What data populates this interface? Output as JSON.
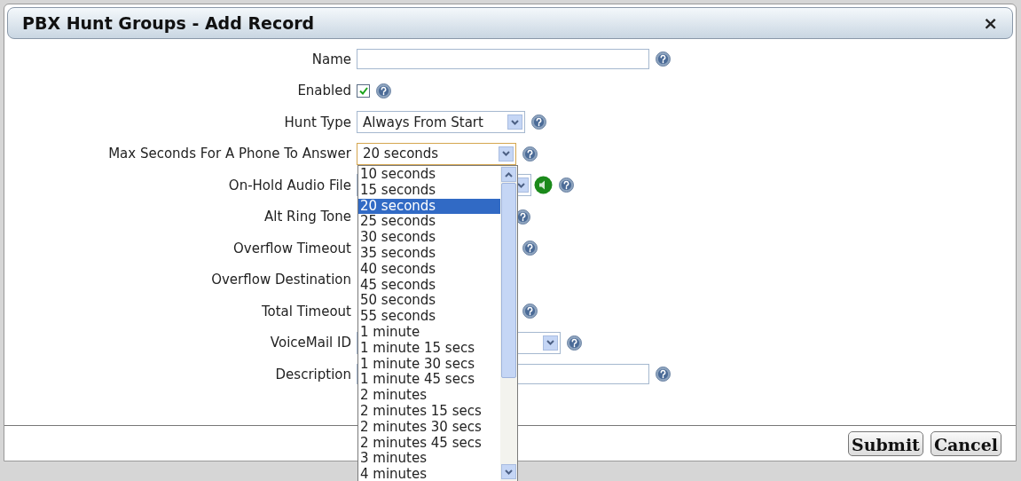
{
  "dialog": {
    "title": "PBX Hunt Groups - Add Record",
    "close": "×"
  },
  "fields": [
    {
      "label": "Name",
      "kind": "text",
      "help": true
    },
    {
      "label": "Enabled",
      "kind": "checkbox",
      "checked": true,
      "help": true
    },
    {
      "label": "Hunt Type",
      "kind": "select",
      "value": "Always From Start",
      "help": true
    },
    {
      "label": "Max Seconds For A Phone To Answer",
      "kind": "select",
      "value": "20 seconds",
      "focused": true,
      "help": true
    },
    {
      "label": "On-Hold Audio File",
      "kind": "audio",
      "help": true
    },
    {
      "label": "Alt Ring Tone",
      "kind": "covered",
      "help": true
    },
    {
      "label": "Overflow Timeout",
      "kind": "covered",
      "help": true
    },
    {
      "label": "Overflow Destination",
      "kind": "covered",
      "help": false
    },
    {
      "label": "Total Timeout",
      "kind": "covered",
      "help": true
    },
    {
      "label": "VoiceMail ID",
      "kind": "select",
      "help": true
    },
    {
      "label": "Description",
      "kind": "text",
      "help": true
    }
  ],
  "dropdown": {
    "options": [
      {
        "label": "10 seconds",
        "selected": false
      },
      {
        "label": "15 seconds",
        "selected": false
      },
      {
        "label": "20 seconds",
        "selected": true
      },
      {
        "label": "25 seconds",
        "selected": false
      },
      {
        "label": "30 seconds",
        "selected": false
      },
      {
        "label": "35 seconds",
        "selected": false
      },
      {
        "label": "40 seconds",
        "selected": false
      },
      {
        "label": "45 seconds",
        "selected": false
      },
      {
        "label": "50 seconds",
        "selected": false
      },
      {
        "label": "55 seconds",
        "selected": false
      },
      {
        "label": "1 minute",
        "selected": false
      },
      {
        "label": "1 minute 15 secs",
        "selected": false
      },
      {
        "label": "1 minute 30 secs",
        "selected": false
      },
      {
        "label": "1 minute 45 secs",
        "selected": false
      },
      {
        "label": "2 minutes",
        "selected": false
      },
      {
        "label": "2 minutes 15 secs",
        "selected": false
      },
      {
        "label": "2 minutes 30 secs",
        "selected": false
      },
      {
        "label": "2 minutes 45 secs",
        "selected": false
      },
      {
        "label": "3 minutes",
        "selected": false
      },
      {
        "label": "4 minutes",
        "selected": false
      }
    ]
  },
  "buttons": [
    "Submit",
    "Cancel"
  ]
}
